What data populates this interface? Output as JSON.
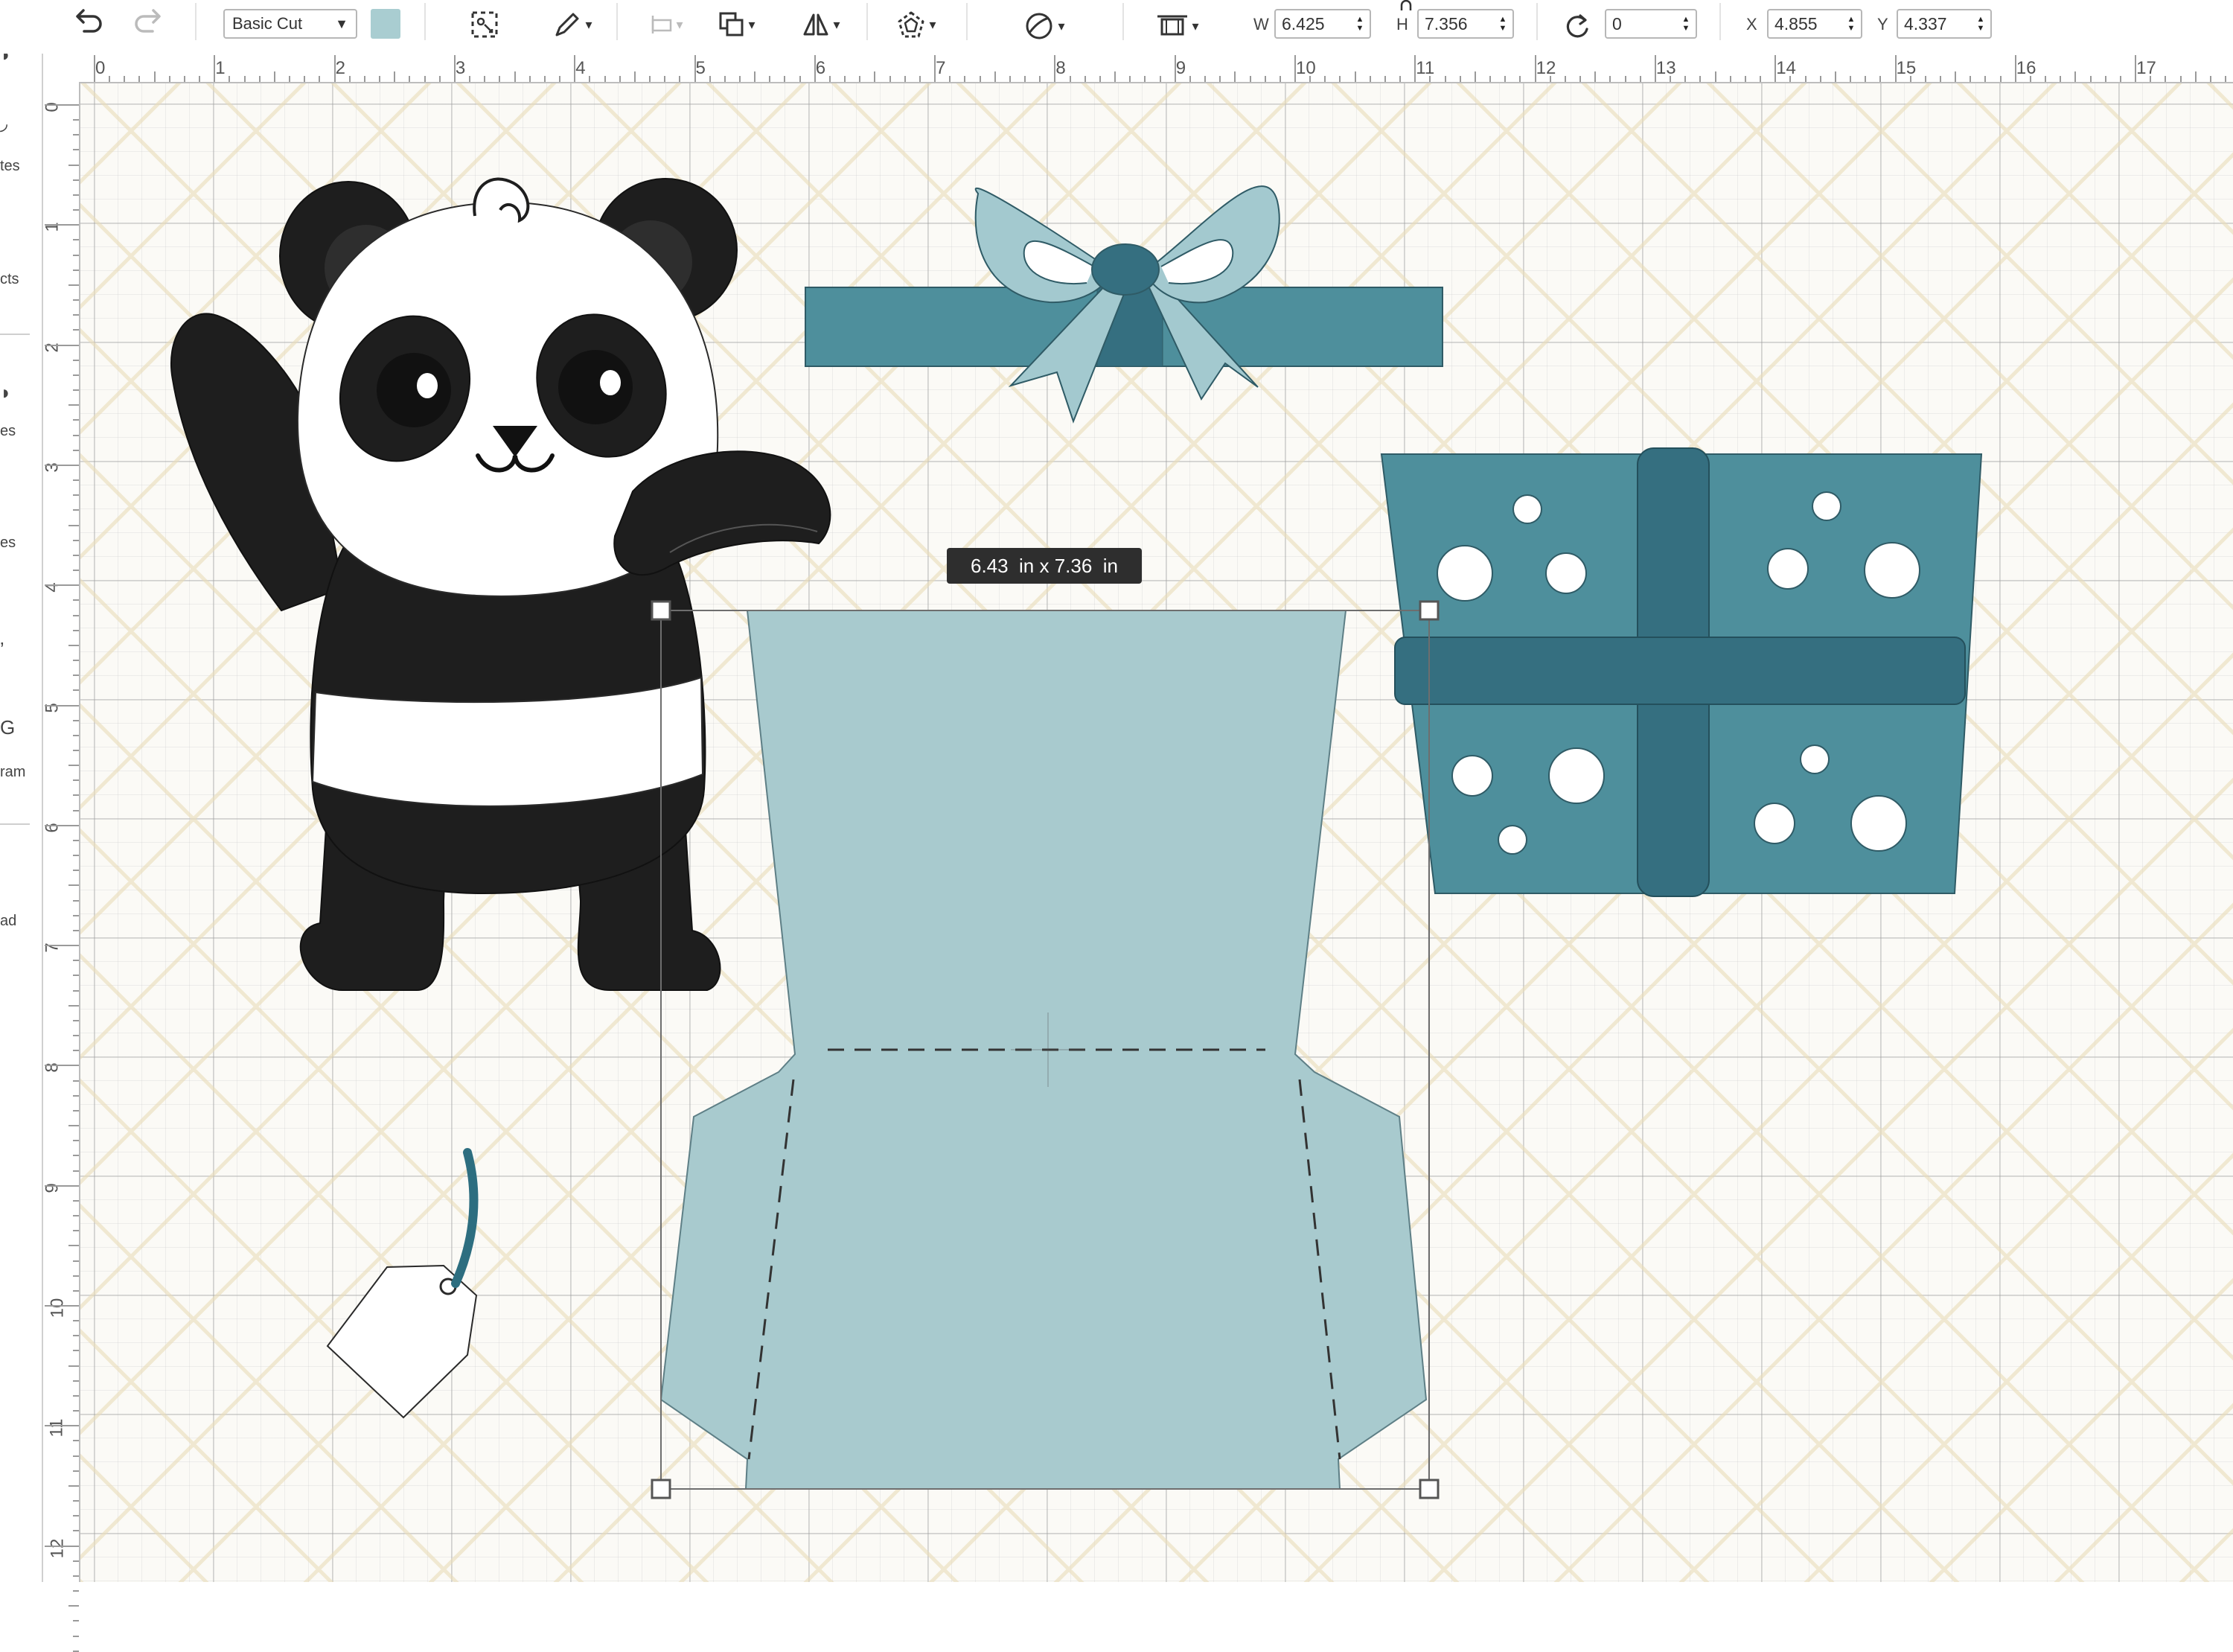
{
  "toolbar": {
    "undo_icon": "undo-icon",
    "redo_icon": "redo-icon",
    "operation": "Basic Cut",
    "operation_color": "#a9cdd1",
    "width_label": "W",
    "width_value": "6.425",
    "height_label": "H",
    "height_value": "7.356",
    "rotate_value": "0",
    "x_label": "X",
    "x_value": "4.855",
    "y_label": "Y",
    "y_value": "4.337"
  },
  "sidebar": {
    "labels": [
      "tes",
      "cts",
      "es",
      "es",
      "ram",
      "ad"
    ]
  },
  "rulers": {
    "top": [
      "0",
      "1",
      "2",
      "3",
      "4",
      "5",
      "6",
      "7",
      "8",
      "9",
      "10",
      "11",
      "12",
      "13",
      "14",
      "15",
      "16",
      "17"
    ],
    "left": [
      "0",
      "1",
      "2",
      "3",
      "4",
      "5",
      "6",
      "7",
      "8",
      "9",
      "10",
      "11",
      "12"
    ]
  },
  "canvas": {
    "selection_tooltip": "6.43  in x 7.36  in",
    "colors": {
      "panda_black": "#1e1e1e",
      "gift_dark": "#4e8f9c",
      "ribbon": "#356f80",
      "light_box": "#a8cace",
      "bow_light": "#a3c9cf",
      "tag_string": "#2d6e80"
    }
  }
}
